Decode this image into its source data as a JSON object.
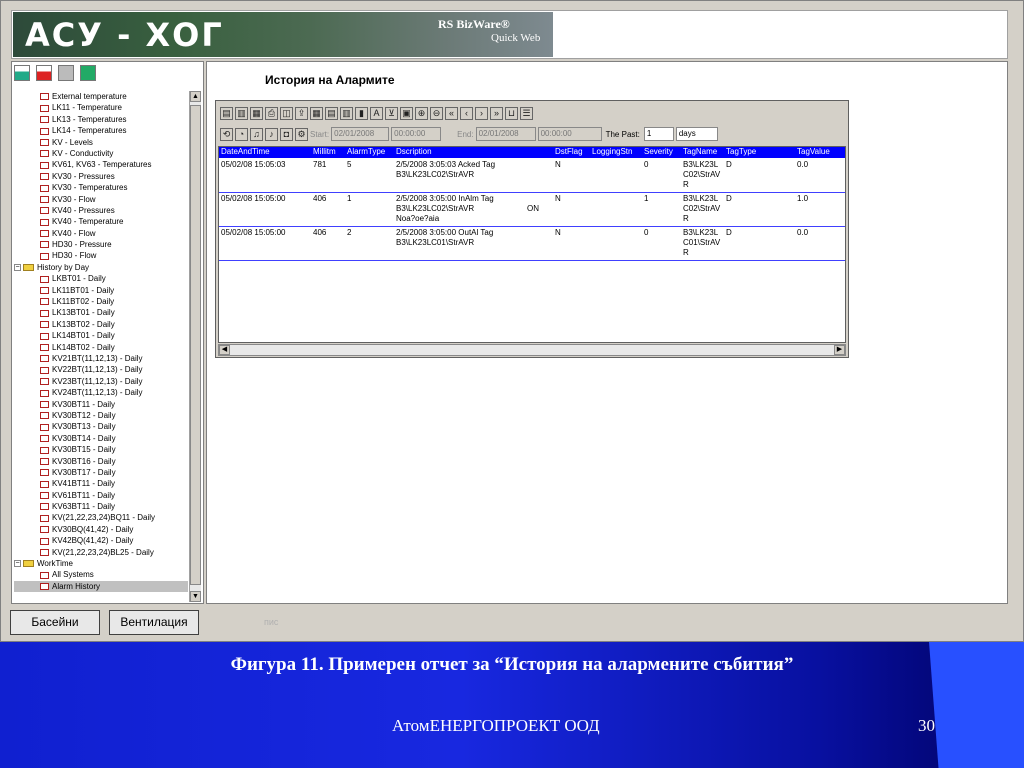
{
  "header": {
    "title": "АСУ - ХОГ",
    "brand": "RS BizWare®",
    "subtitle": "Quick Web"
  },
  "tree": {
    "items": [
      {
        "label": "External temperature",
        "type": "item"
      },
      {
        "label": "LK11 - Temperature",
        "type": "item"
      },
      {
        "label": "LK13 - Temperatures",
        "type": "item"
      },
      {
        "label": "LK14 - Temperatures",
        "type": "item"
      },
      {
        "label": "KV - Levels",
        "type": "item"
      },
      {
        "label": "KV - Conductivity",
        "type": "item"
      },
      {
        "label": "KV61, KV63 - Temperatures",
        "type": "item"
      },
      {
        "label": "KV30 - Pressures",
        "type": "item"
      },
      {
        "label": "KV30 - Temperatures",
        "type": "item"
      },
      {
        "label": "KV30 - Flow",
        "type": "item"
      },
      {
        "label": "KV40 - Pressures",
        "type": "item"
      },
      {
        "label": "KV40 - Temperature",
        "type": "item"
      },
      {
        "label": "KV40 - Flow",
        "type": "item"
      },
      {
        "label": "HD30 - Pressure",
        "type": "item"
      },
      {
        "label": "HD30 - Flow",
        "type": "item"
      },
      {
        "label": "History by Day",
        "type": "folder"
      },
      {
        "label": "LKBT01 - Daily",
        "type": "item"
      },
      {
        "label": "LK11BT01 - Daily",
        "type": "item"
      },
      {
        "label": "LK11BT02 - Daily",
        "type": "item"
      },
      {
        "label": "LK13BT01 - Daily",
        "type": "item"
      },
      {
        "label": "LK13BT02 - Daily",
        "type": "item"
      },
      {
        "label": "LK14BT01 - Daily",
        "type": "item"
      },
      {
        "label": "LK14BT02 - Daily",
        "type": "item"
      },
      {
        "label": "KV21BT(11,12,13) - Daily",
        "type": "item"
      },
      {
        "label": "KV22BT(11,12,13) - Daily",
        "type": "item"
      },
      {
        "label": "KV23BT(11,12,13) - Daily",
        "type": "item"
      },
      {
        "label": "KV24BT(11,12,13) - Daily",
        "type": "item"
      },
      {
        "label": "KV30BT11 - Daily",
        "type": "item"
      },
      {
        "label": "KV30BT12 - Daily",
        "type": "item"
      },
      {
        "label": "KV30BT13 - Daily",
        "type": "item"
      },
      {
        "label": "KV30BT14 - Daily",
        "type": "item"
      },
      {
        "label": "KV30BT15 - Daily",
        "type": "item"
      },
      {
        "label": "KV30BT16 - Daily",
        "type": "item"
      },
      {
        "label": "KV30BT17 - Daily",
        "type": "item"
      },
      {
        "label": "KV41BT11 - Daily",
        "type": "item"
      },
      {
        "label": "KV61BT11 - Daily",
        "type": "item"
      },
      {
        "label": "KV63BT11 - Daily",
        "type": "item"
      },
      {
        "label": "KV(21,22,23,24)BQ11 - Daily",
        "type": "item"
      },
      {
        "label": "KV30BQ(41,42) - Daily",
        "type": "item"
      },
      {
        "label": "KV42BQ(41,42) - Daily",
        "type": "item"
      },
      {
        "label": "KV(21,22,23,24)BL25 - Daily",
        "type": "item"
      },
      {
        "label": "WorkTime",
        "type": "folder"
      },
      {
        "label": "All Systems",
        "type": "item"
      },
      {
        "label": "Alarm History",
        "type": "item",
        "selected": true
      }
    ]
  },
  "main": {
    "title": "История на Алармите",
    "filter": {
      "start_label": "Start:",
      "start_date": "02/01/2008",
      "start_time": "00:00:00",
      "end_label": "End:",
      "end_date": "02/01/2008",
      "end_time": "00:00:00",
      "past_label": "The Past:",
      "past_value": "1",
      "past_unit": "days"
    },
    "columns": [
      "DateAndTime",
      "Millitm",
      "AlarmType",
      "Dscription",
      "DstFlag",
      "LoggingStn",
      "Severity",
      "TagName",
      "TagType",
      "TagValue"
    ],
    "rows": [
      {
        "DateAndTime": "05/02/08 15:05:03",
        "Millitm": "781",
        "AlarmType": "5",
        "Dscription": "2/5/2008   3:05:03  Acked Tag\nB3\\LK23LC02\\StrAVR",
        "DstFlag": "N",
        "LoggingStn": "",
        "Severity": "0",
        "TagName": "B3\\LK23L\nC02\\StrAV\nR",
        "TagType": "D",
        "TagValue": "0.0"
      },
      {
        "DateAndTime": "05/02/08 15:05:00",
        "Millitm": "406",
        "AlarmType": "1",
        "Dscription": "2/5/2008   3:05:00  InAlm Tag\nB3\\LK23LC02\\StrAVR\nNoa?oe?aia",
        "Extra": "ON",
        "DstFlag": "N",
        "LoggingStn": "",
        "Severity": "1",
        "TagName": "B3\\LK23L\nC02\\StrAV\nR",
        "TagType": "D",
        "TagValue": "1.0"
      },
      {
        "DateAndTime": "05/02/08 15:05:00",
        "Millitm": "406",
        "AlarmType": "2",
        "Dscription": "2/5/2008   3:05:00  OutAl Tag\nB3\\LK23LC01\\StrAVR",
        "DstFlag": "N",
        "LoggingStn": "",
        "Severity": "0",
        "TagName": "B3\\LK23L\nC01\\StrAV\nR",
        "TagType": "D",
        "TagValue": "0.0"
      }
    ]
  },
  "buttons": {
    "pools": "Басейни",
    "ventilation": "Вентилация"
  },
  "ghost_text": "пис",
  "slide": {
    "caption": "Фигура 11. Примерен отчет за “История на алармените събития”",
    "company": "АтомЕНЕРГОПРОЕКТ ООД",
    "number": "30"
  },
  "colors": {
    "grid_header": "#0000ff",
    "slide_bg": "#1020d0"
  }
}
